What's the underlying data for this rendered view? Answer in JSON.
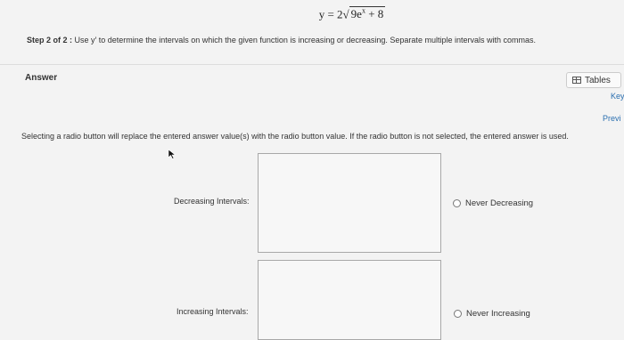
{
  "equation": {
    "lhs": "y = 2",
    "radicand": "9e",
    "exponent": "x",
    "tail": " + 8"
  },
  "step": {
    "label": "Step 2 of 2 :",
    "text_before": "Use y",
    "prime": "′",
    "text_after": " to determine the intervals on which the given function is increasing or decreasing. Separate multiple intervals with commas."
  },
  "answer": {
    "label": "Answer",
    "tables_label": "Tables",
    "tables_icon": "table-icon",
    "key_label": "Key",
    "preview_label": "Previ",
    "instructions": "Selecting a radio button will replace the entered answer value(s) with the radio button value. If the radio button is not selected, the entered answer is used."
  },
  "fields": {
    "decreasing_label": "Decreasing Intervals:",
    "increasing_label": "Increasing Intervals:",
    "decreasing_value": "",
    "increasing_value": ""
  },
  "radios": {
    "never_decreasing": "Never Decreasing",
    "never_increasing": "Never Increasing"
  }
}
